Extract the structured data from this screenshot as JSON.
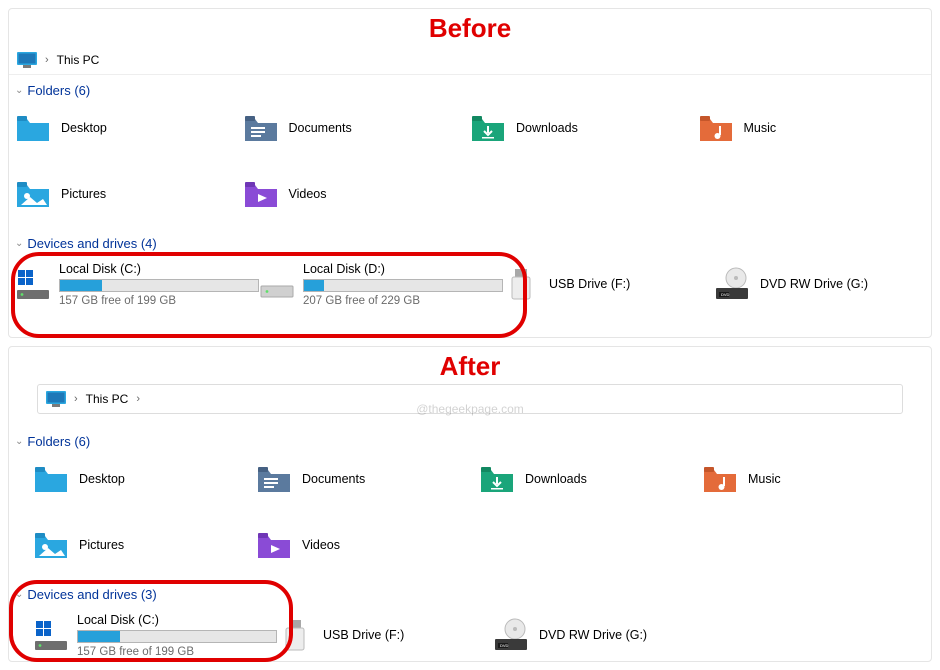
{
  "labels": {
    "before": "Before",
    "after": "After",
    "watermark": "@thegeekpage.com"
  },
  "before": {
    "breadcrumb": {
      "root": "This PC"
    },
    "folders_header": "Folders (6)",
    "folders": [
      {
        "name": "Desktop"
      },
      {
        "name": "Documents"
      },
      {
        "name": "Downloads"
      },
      {
        "name": "Music"
      },
      {
        "name": "Pictures"
      },
      {
        "name": "Videos"
      }
    ],
    "drives_header": "Devices and drives (4)",
    "drives": {
      "c": {
        "name": "Local Disk (C:)",
        "free": "157 GB free of 199 GB",
        "fill_pct": 21
      },
      "d": {
        "name": "Local Disk (D:)",
        "free": "207 GB free of 229 GB",
        "fill_pct": 10
      },
      "usb": {
        "name": "USB Drive (F:)"
      },
      "dvd": {
        "name": "DVD RW Drive (G:)"
      }
    }
  },
  "after": {
    "breadcrumb": {
      "root": "This PC"
    },
    "folders_header": "Folders (6)",
    "folders": [
      {
        "name": "Desktop"
      },
      {
        "name": "Documents"
      },
      {
        "name": "Downloads"
      },
      {
        "name": "Music"
      },
      {
        "name": "Pictures"
      },
      {
        "name": "Videos"
      }
    ],
    "drives_header": "Devices and drives (3)",
    "drives": {
      "c": {
        "name": "Local Disk (C:)",
        "free": "157 GB free of 199 GB",
        "fill_pct": 21
      },
      "usb": {
        "name": "USB Drive (F:)"
      },
      "dvd": {
        "name": "DVD RW Drive (G:)"
      }
    }
  }
}
